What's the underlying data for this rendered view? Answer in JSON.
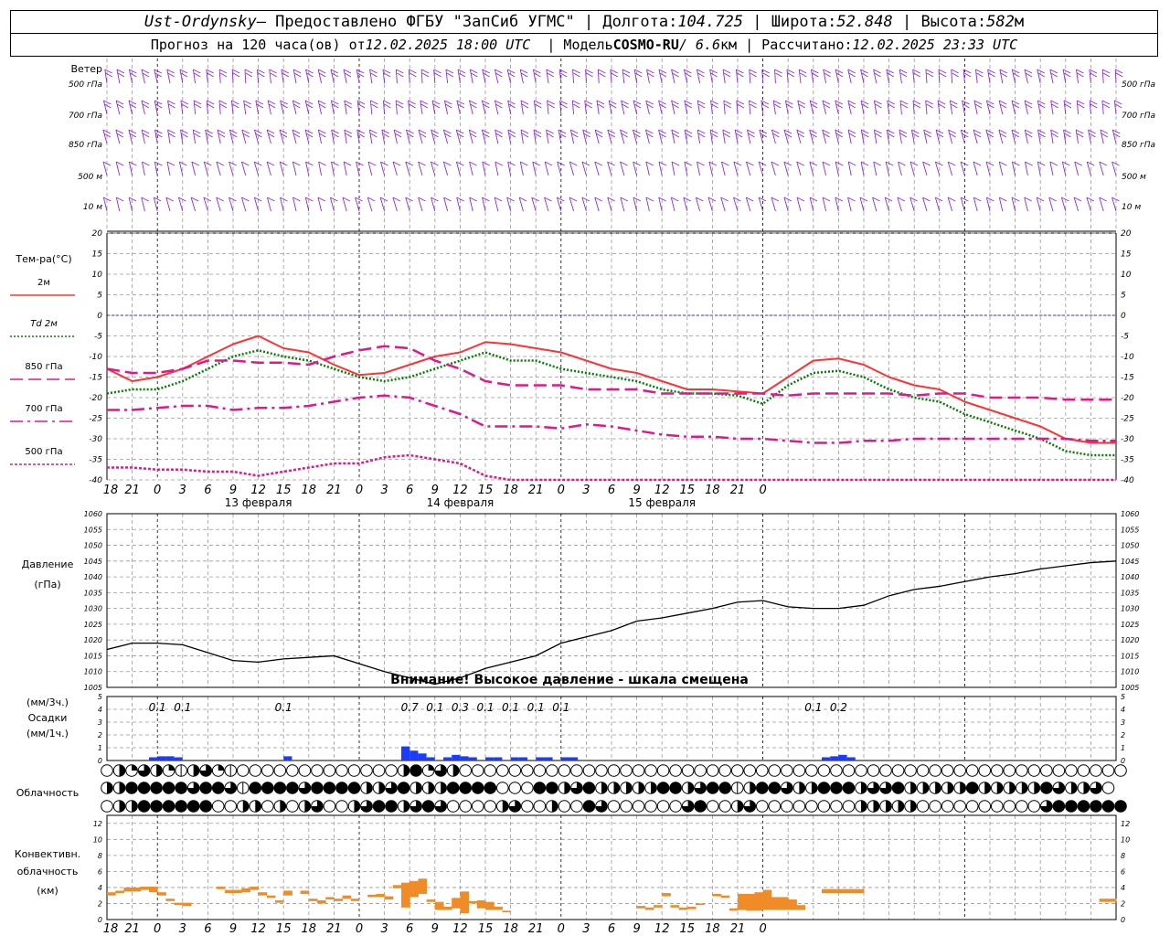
{
  "header": {
    "station": "Ust-Ordynsky",
    "provided_by": "— Предоставлено ФГБУ \"ЗапСиб УГМС\"",
    "lon_label": "Долгота:",
    "lon_value": "104.725",
    "lat_label": "Широта:",
    "lat_value": "52.848",
    "alt_label": "Высота:",
    "alt_value": "582",
    "alt_unit": "м",
    "forecast_label": "Прогноз на 120 часа(ов) от",
    "forecast_from": "12.02.2025 18:00 UTC",
    "model_label": "Модель",
    "model_name": "COSMO-RU",
    "model_res": "/ 6.6",
    "model_res_unit": "км",
    "calc_label": "Рассчитано:",
    "calc_value": "12.02.2025 23:33 UTC"
  },
  "colors": {
    "t2m": "#ff3333",
    "td2m": "#008000",
    "p850": "#e0188c",
    "wind": "#8a2be2",
    "zero_line": "#3333cc",
    "precip": "#1a3cff",
    "conv": "#f08c28",
    "grid": "#999999"
  },
  "time_axis": {
    "hour_labels": [
      "18",
      "21",
      "0",
      "3",
      "6",
      "9",
      "12",
      "15",
      "18",
      "21",
      "0",
      "3",
      "6",
      "9",
      "12",
      "15",
      "18",
      "21",
      "0",
      "3",
      "6",
      "9",
      "12",
      "15",
      "18",
      "21",
      "0"
    ],
    "date_labels": [
      "13 февраля",
      "14 февраля",
      "15 февраля"
    ]
  },
  "wind_panel": {
    "title": "Ветер",
    "levels": [
      "500 гПа",
      "700 гПа",
      "850 гПа",
      "500 м",
      "10 м"
    ]
  },
  "chart_data": [
    {
      "type": "line",
      "title": "Тем-ра(°С)",
      "ylim": [
        -40,
        20
      ],
      "yticks": [
        "20",
        "15",
        "10",
        "5",
        "0",
        "-5",
        "-10",
        "-15",
        "-20",
        "-25",
        "-30",
        "-35",
        "-40"
      ],
      "x_hours_from_start": [
        0,
        3,
        6,
        9,
        12,
        15,
        18,
        21,
        24,
        27,
        30,
        33,
        36,
        39,
        42,
        45,
        48,
        51,
        54,
        57,
        60,
        63,
        66,
        69,
        72,
        75,
        78,
        81,
        84,
        87,
        90,
        93,
        96,
        99,
        102,
        105,
        108,
        111,
        114,
        117,
        120
      ],
      "series": [
        {
          "name": "2м",
          "style": "solid",
          "color_key": "t2m",
          "values": [
            -13,
            -16,
            -15,
            -13,
            -10,
            -7,
            -5,
            -8,
            -9,
            -12,
            -14.5,
            -14,
            -12,
            -10,
            -9,
            -6.5,
            -7,
            -8,
            -9,
            -11,
            -13,
            -14,
            -16,
            -18,
            -18,
            -18.5,
            -19,
            -15,
            -11,
            -10.5,
            -12,
            -15,
            -17,
            -18,
            -21,
            -23,
            -25,
            -27,
            -30,
            -31,
            -31
          ]
        },
        {
          "name": "Td 2м",
          "style": "dotted",
          "color_key": "td2m",
          "values": [
            -19,
            -18,
            -18,
            -16,
            -13,
            -10,
            -8.5,
            -10,
            -11,
            -13,
            -15,
            -16,
            -15,
            -13,
            -11,
            -9,
            -11,
            -11,
            -13,
            -14,
            -15,
            -16,
            -18,
            -19,
            -19,
            -19.5,
            -21.5,
            -17,
            -14,
            -13.5,
            -15,
            -18,
            -20,
            -21,
            -24,
            -26,
            -28,
            -30,
            -33,
            -34,
            -34
          ]
        },
        {
          "name": "850 гПа",
          "style": "dashed",
          "color_key": "p850",
          "values": [
            -13,
            -14,
            -14,
            -13,
            -11,
            -11,
            -11.5,
            -11.5,
            -12,
            -10,
            -8.5,
            -7.5,
            -8,
            -11,
            -13,
            -16,
            -17,
            -17,
            -17,
            -18,
            -18,
            -18,
            -19,
            -19,
            -19,
            -19,
            -19,
            -19.5,
            -19,
            -19,
            -19,
            -19,
            -19.5,
            -19,
            -19,
            -20,
            -20,
            -20,
            -20.5,
            -20.5,
            -20.5
          ]
        },
        {
          "name": "700 гПа",
          "style": "dashdot",
          "color_key": "p850",
          "values": [
            -23,
            -23,
            -22.5,
            -22,
            -22,
            -23,
            -22.5,
            -22.5,
            -22,
            -21,
            -20,
            -19.5,
            -20,
            -22,
            -24,
            -27,
            -27,
            -27,
            -27.5,
            -26.5,
            -27,
            -28,
            -29,
            -29.5,
            -29.5,
            -30,
            -30,
            -30.5,
            -31,
            -31,
            -30.5,
            -30.5,
            -30,
            -30,
            -30,
            -30,
            -30,
            -30,
            -30,
            -30.5,
            -30.5
          ]
        },
        {
          "name": "500 гПа",
          "style": "finedash",
          "color_key": "p850",
          "values": [
            -37,
            -37,
            -37.5,
            -37.5,
            -38,
            -38,
            -39,
            -38,
            -37,
            -36,
            -36,
            -34.5,
            -34,
            -35,
            -36,
            -39,
            -41,
            -41,
            -41,
            -41,
            -41,
            -41,
            -41,
            -41,
            -41,
            -41,
            -41,
            -41,
            -41,
            -41,
            -41,
            -41,
            -41,
            -41,
            -41,
            -41,
            -41,
            -41,
            -41,
            -41,
            -41
          ]
        }
      ]
    },
    {
      "type": "line",
      "title": "Давление",
      "unit": "(гПа)",
      "ylim": [
        1005,
        1060
      ],
      "yticks": [
        "1060",
        "1055",
        "1050",
        "1045",
        "1040",
        "1035",
        "1030",
        "1025",
        "1020",
        "1015",
        "1010",
        "1005"
      ],
      "annotation": "Внимание! Высокое давление - шкала смещена",
      "x_hours_from_start": [
        0,
        3,
        6,
        9,
        12,
        15,
        18,
        21,
        24,
        27,
        30,
        33,
        36,
        39,
        42,
        45,
        48,
        51,
        54,
        57,
        60,
        63,
        66,
        69,
        72,
        75,
        78,
        81,
        84,
        87,
        90,
        93,
        96,
        99,
        102,
        105,
        108,
        111,
        114,
        117,
        120
      ],
      "series": [
        {
          "name": "",
          "values": [
            1017,
            1019,
            1019,
            1018.5,
            1016,
            1013.5,
            1013,
            1014,
            1014.5,
            1015,
            1012.5,
            1010,
            1008,
            1006,
            1008,
            1011,
            1013,
            1015,
            1019,
            1021,
            1023,
            1026,
            1027,
            1028.5,
            1030,
            1032,
            1032.5,
            1030.5,
            1030,
            1030,
            1031,
            1034,
            1036,
            1037,
            1038.5,
            1040,
            1041,
            1042.5,
            1043.5,
            1044.5,
            1045
          ]
        }
      ]
    },
    {
      "type": "bar",
      "title": "Осадки",
      "units_top": "(мм/3ч.)",
      "units_bottom": "(мм/1ч.)",
      "ylim": [
        0,
        5
      ],
      "yticks": [
        "5",
        "4",
        "3",
        "2",
        "1",
        "0"
      ],
      "totals_3h": [
        {
          "hour": 6,
          "text": "0.1"
        },
        {
          "hour": 9,
          "text": "0.1"
        },
        {
          "hour": 21,
          "text": "0.1"
        },
        {
          "hour": 36,
          "text": "0.7"
        },
        {
          "hour": 39,
          "text": "0.1"
        },
        {
          "hour": 42,
          "text": "0.3"
        },
        {
          "hour": 45,
          "text": "0.1"
        },
        {
          "hour": 48,
          "text": "0.1"
        },
        {
          "hour": 51,
          "text": "0.1"
        },
        {
          "hour": 54,
          "text": "0.1"
        },
        {
          "hour": 84,
          "text": "0.1"
        },
        {
          "hour": 87,
          "text": "0.2"
        }
      ],
      "hourly": [
        {
          "h": 5,
          "v": 0.1
        },
        {
          "h": 6,
          "v": 0.15
        },
        {
          "h": 7,
          "v": 0.15
        },
        {
          "h": 8,
          "v": 0.1
        },
        {
          "h": 21,
          "v": 0.15
        },
        {
          "h": 35,
          "v": 0.5
        },
        {
          "h": 36,
          "v": 0.35
        },
        {
          "h": 37,
          "v": 0.25
        },
        {
          "h": 38,
          "v": 0.1
        },
        {
          "h": 40,
          "v": 0.1
        },
        {
          "h": 41,
          "v": 0.2
        },
        {
          "h": 42,
          "v": 0.15
        },
        {
          "h": 43,
          "v": 0.1
        },
        {
          "h": 45,
          "v": 0.1
        },
        {
          "h": 46,
          "v": 0.1
        },
        {
          "h": 48,
          "v": 0.05
        },
        {
          "h": 49,
          "v": 0.05
        },
        {
          "h": 51,
          "v": 0.05
        },
        {
          "h": 52,
          "v": 0.05
        },
        {
          "h": 54,
          "v": 0.05
        },
        {
          "h": 55,
          "v": 0.05
        },
        {
          "h": 85,
          "v": 0.1
        },
        {
          "h": 86,
          "v": 0.15
        },
        {
          "h": 87,
          "v": 0.2
        },
        {
          "h": 88,
          "v": 0.1
        }
      ]
    },
    {
      "type": "bar",
      "title": "Конвективн. облачность",
      "unit": "(км)",
      "ylim": [
        0,
        13
      ],
      "yticks": [
        "12",
        "10",
        "8",
        "6",
        "4",
        "2",
        "0"
      ],
      "segments": [
        {
          "h": 0,
          "bottom": 3,
          "top": 3.4
        },
        {
          "h": 1,
          "bottom": 3.3,
          "top": 3.6
        },
        {
          "h": 2,
          "bottom": 3.5,
          "top": 4
        },
        {
          "h": 3,
          "bottom": 3.5,
          "top": 4
        },
        {
          "h": 4,
          "bottom": 3.7,
          "top": 4.1
        },
        {
          "h": 5,
          "bottom": 3.4,
          "top": 4.1
        },
        {
          "h": 6,
          "bottom": 3,
          "top": 3.4
        },
        {
          "h": 7,
          "bottom": 2.3,
          "top": 2.6
        },
        {
          "h": 8,
          "bottom": 1.8,
          "top": 2.1
        },
        {
          "h": 9,
          "bottom": 1.7,
          "top": 2.1
        },
        {
          "h": 13,
          "bottom": 3.8,
          "top": 4.1
        },
        {
          "h": 14,
          "bottom": 3.3,
          "top": 3.7
        },
        {
          "h": 15,
          "bottom": 3.3,
          "top": 3.7
        },
        {
          "h": 16,
          "bottom": 3.4,
          "top": 3.9
        },
        {
          "h": 17,
          "bottom": 3.7,
          "top": 4.1
        },
        {
          "h": 18,
          "bottom": 3,
          "top": 3.4
        },
        {
          "h": 19,
          "bottom": 2.7,
          "top": 3
        },
        {
          "h": 20,
          "bottom": 2.1,
          "top": 2.4
        },
        {
          "h": 21,
          "bottom": 3,
          "top": 3.6
        },
        {
          "h": 23,
          "bottom": 3.2,
          "top": 3.6
        },
        {
          "h": 24,
          "bottom": 2.3,
          "top": 2.6
        },
        {
          "h": 25,
          "bottom": 2,
          "top": 2.4
        },
        {
          "h": 26,
          "bottom": 2.5,
          "top": 2.8
        },
        {
          "h": 27,
          "bottom": 2.3,
          "top": 2.6
        },
        {
          "h": 28,
          "bottom": 2.6,
          "top": 3
        },
        {
          "h": 29,
          "bottom": 2.3,
          "top": 2.6
        },
        {
          "h": 31,
          "bottom": 2.8,
          "top": 3.1
        },
        {
          "h": 32,
          "bottom": 2.8,
          "top": 3.2
        },
        {
          "h": 33,
          "bottom": 2.5,
          "top": 2.9
        },
        {
          "h": 34,
          "bottom": 3.9,
          "top": 4.3
        },
        {
          "h": 35,
          "bottom": 1.5,
          "top": 4.6
        },
        {
          "h": 36,
          "bottom": 2.8,
          "top": 4.8
        },
        {
          "h": 37,
          "bottom": 3.2,
          "top": 5.1
        },
        {
          "h": 38,
          "bottom": 2.2,
          "top": 2.5
        },
        {
          "h": 39,
          "bottom": 1.2,
          "top": 2.2
        },
        {
          "h": 40,
          "bottom": 1.2,
          "top": 1.6
        },
        {
          "h": 41,
          "bottom": 1.4,
          "top": 2.7
        },
        {
          "h": 42,
          "bottom": 0.8,
          "top": 3.5
        },
        {
          "h": 43,
          "bottom": 2,
          "top": 2.3
        },
        {
          "h": 44,
          "bottom": 1.4,
          "top": 2.4
        },
        {
          "h": 45,
          "bottom": 1.2,
          "top": 2.2
        },
        {
          "h": 46,
          "bottom": 1.2,
          "top": 1.6
        },
        {
          "h": 47,
          "bottom": 0.9,
          "top": 1.1
        },
        {
          "h": 63,
          "bottom": 1.4,
          "top": 1.7
        },
        {
          "h": 64,
          "bottom": 1.2,
          "top": 1.5
        },
        {
          "h": 65,
          "bottom": 1.5,
          "top": 1.8
        },
        {
          "h": 66,
          "bottom": 2.9,
          "top": 3.3
        },
        {
          "h": 67,
          "bottom": 1.5,
          "top": 1.8
        },
        {
          "h": 68,
          "bottom": 1.2,
          "top": 1.5
        },
        {
          "h": 69,
          "bottom": 1.3,
          "top": 1.6
        },
        {
          "h": 70,
          "bottom": 1.8,
          "top": 2
        },
        {
          "h": 72,
          "bottom": 2.9,
          "top": 3.2
        },
        {
          "h": 73,
          "bottom": 2.7,
          "top": 3
        },
        {
          "h": 74,
          "bottom": 1.1,
          "top": 1.4
        },
        {
          "h": 75,
          "bottom": 1.2,
          "top": 3.2
        },
        {
          "h": 76,
          "bottom": 1.1,
          "top": 3.2
        },
        {
          "h": 77,
          "bottom": 1.1,
          "top": 3.4
        },
        {
          "h": 78,
          "bottom": 1.2,
          "top": 3.7
        },
        {
          "h": 79,
          "bottom": 1.2,
          "top": 2.8
        },
        {
          "h": 80,
          "bottom": 1.2,
          "top": 2.8
        },
        {
          "h": 81,
          "bottom": 1.2,
          "top": 2.5
        },
        {
          "h": 82,
          "bottom": 1.2,
          "top": 1.8
        },
        {
          "h": 85,
          "bottom": 3.3,
          "top": 3.8
        },
        {
          "h": 86,
          "bottom": 3.3,
          "top": 3.8
        },
        {
          "h": 87,
          "bottom": 3.3,
          "top": 3.8
        },
        {
          "h": 88,
          "bottom": 3.3,
          "top": 3.8
        },
        {
          "h": 89,
          "bottom": 3.3,
          "top": 3.8
        },
        {
          "h": 118,
          "bottom": 2.2,
          "top": 2.6
        },
        {
          "h": 119,
          "bottom": 2.2,
          "top": 2.6
        }
      ]
    }
  ],
  "cloud_panel": {
    "title": "Облачность",
    "rows": [
      "ahnqhnmhqnmaaaaaaaaaaaaahfnqhaaaaaaaaaaaaaaaaaaaaaaaaaaaaaaaaaaaaaaaaaaaaaaaaaaaaaa",
      "hhfffffqffqmffffqffffhhqfhhhffffaaaffhqfhhhhhffhqffmhffqhhfffhqqfhhhhhfhhhhhfqhhqa",
      "ahhffffffaahhahahqaahqffhqfqaaaahqaahaafqaaaaaaqfaahqaaaaaaaahhhhhaaaaaaaaaaqffffff"
    ]
  }
}
